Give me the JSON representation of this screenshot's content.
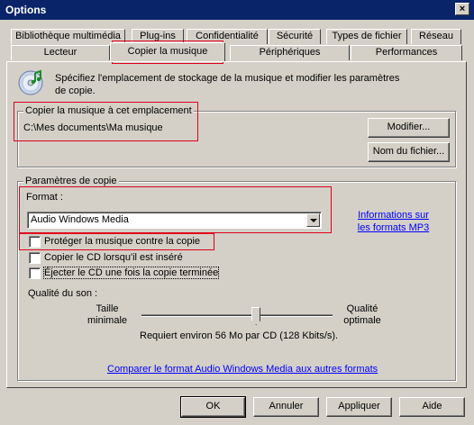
{
  "window": {
    "title": "Options",
    "close_glyph": "×"
  },
  "tabs_row1": [
    {
      "label": "Bibliothèque multimédia"
    },
    {
      "label": "Plug-ins"
    },
    {
      "label": "Confidentialité"
    },
    {
      "label": "Sécurité"
    },
    {
      "label": "Types de fichier"
    },
    {
      "label": "Réseau"
    }
  ],
  "tabs_row2": [
    {
      "label": "Lecteur"
    },
    {
      "label": "Copier la musique",
      "active": true
    },
    {
      "label": "Périphériques"
    },
    {
      "label": "Performances"
    }
  ],
  "header": {
    "icon": "cd-music-icon",
    "description": "Spécifiez l'emplacement de stockage de la musique et modifier les paramètres de copie."
  },
  "location_group": {
    "label": "Copier la musique à cet emplacement",
    "path": "C:\\Mes documents\\Ma musique",
    "modify_button": "Modifier...",
    "filename_button": "Nom du fichier..."
  },
  "settings_group": {
    "label": "Paramètres de copie",
    "format_label": "Format :",
    "format_value": "Audio Windows Media",
    "mp3_link": "Informations sur les formats MP3",
    "checkboxes": [
      {
        "label": "Protéger la musique contre la copie",
        "checked": false
      },
      {
        "label": "Copier le CD lorsqu'il est inséré",
        "checked": false
      },
      {
        "label": "Éjecter le CD une fois la copie terminée",
        "checked": false
      }
    ],
    "quality_label": "Qualité du son :",
    "quality_min_label": "Taille minimale",
    "quality_max_label": "Qualité optimale",
    "quality_level": 0.6,
    "quality_info": "Requiert environ 56 Mo par CD (128 Kbits/s).",
    "compare_link": "Comparer le format Audio Windows Media aux autres formats"
  },
  "footer": {
    "ok": "OK",
    "cancel": "Annuler",
    "apply": "Appliquer",
    "help": "Aide"
  },
  "colors": {
    "titlebar": "#0a246a",
    "face": "#d4d0c8",
    "highlight": "#e0001b",
    "link": "#0000ff"
  }
}
